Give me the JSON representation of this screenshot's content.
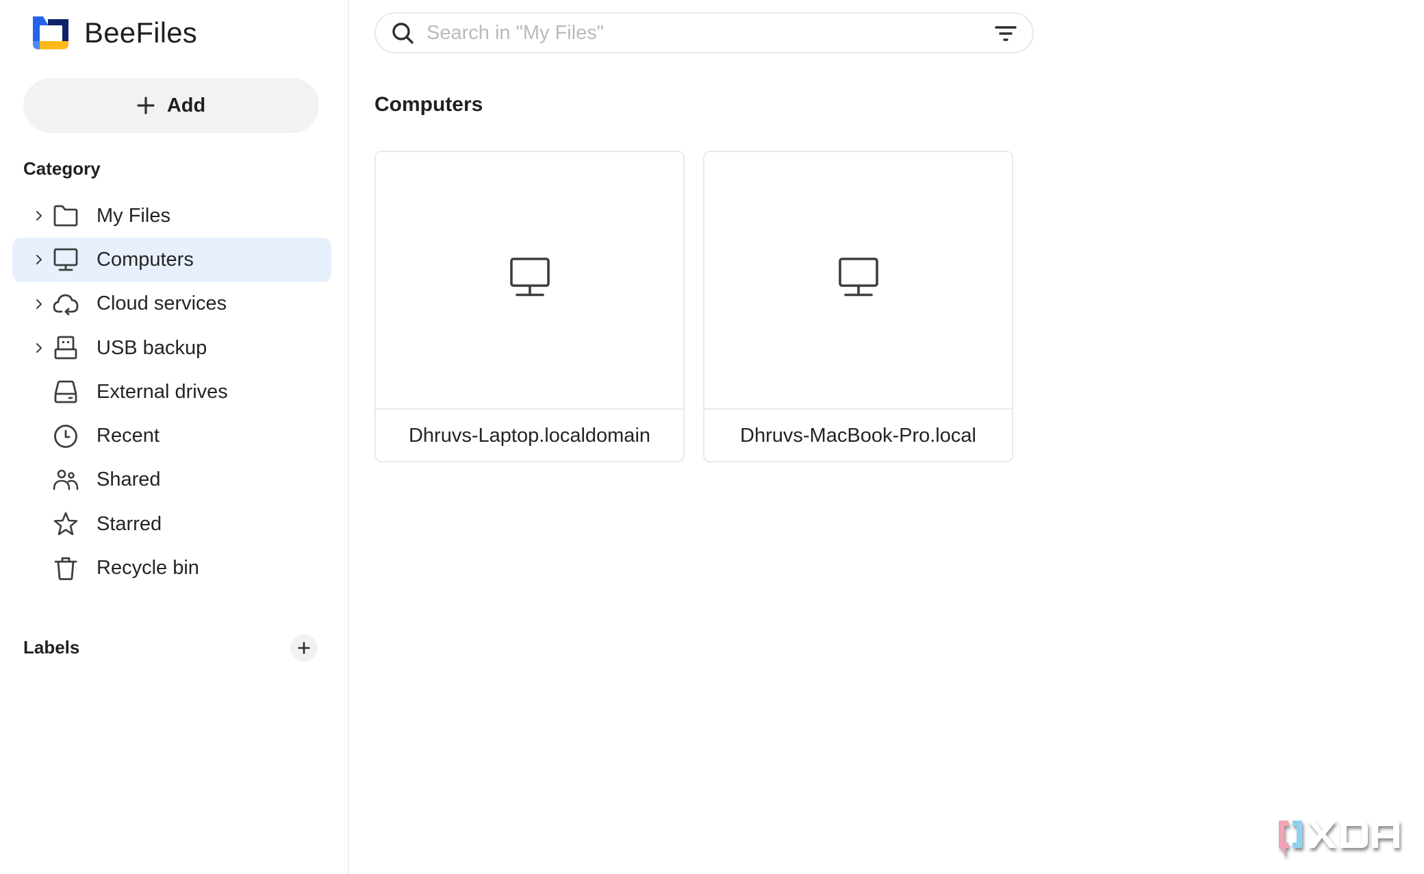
{
  "app": {
    "name": "BeeFiles",
    "logo_colors": {
      "primary": "#2563eb",
      "dark": "#0c2369",
      "accent": "#ffb81c",
      "light": "#4b8bf5"
    }
  },
  "sidebar": {
    "add_button": {
      "label": "Add",
      "icon": "plus-icon"
    },
    "category_title": "Category",
    "items": [
      {
        "label": "My Files",
        "icon": "folder-icon",
        "expandable": true,
        "active": false
      },
      {
        "label": "Computers",
        "icon": "monitor-icon",
        "expandable": true,
        "active": true
      },
      {
        "label": "Cloud services",
        "icon": "cloud-sync-icon",
        "expandable": true,
        "active": false
      },
      {
        "label": "USB backup",
        "icon": "usb-icon",
        "expandable": true,
        "active": false
      },
      {
        "label": "External drives",
        "icon": "hard-drive-icon",
        "expandable": false,
        "active": false
      },
      {
        "label": "Recent",
        "icon": "clock-icon",
        "expandable": false,
        "active": false
      },
      {
        "label": "Shared",
        "icon": "users-icon",
        "expandable": false,
        "active": false
      },
      {
        "label": "Starred",
        "icon": "star-icon",
        "expandable": false,
        "active": false
      },
      {
        "label": "Recycle bin",
        "icon": "trash-icon",
        "expandable": false,
        "active": false
      }
    ],
    "labels_title": "Labels",
    "active_color": "#e8f0fd"
  },
  "search": {
    "placeholder": "Search in \"My Files\"",
    "value": ""
  },
  "main": {
    "title": "Computers",
    "computers": [
      {
        "name": "Dhruvs-Laptop.localdomain",
        "icon": "monitor-icon"
      },
      {
        "name": "Dhruvs-MacBook-Pro.local",
        "icon": "monitor-icon"
      }
    ]
  },
  "watermark": {
    "text": "XDA"
  }
}
